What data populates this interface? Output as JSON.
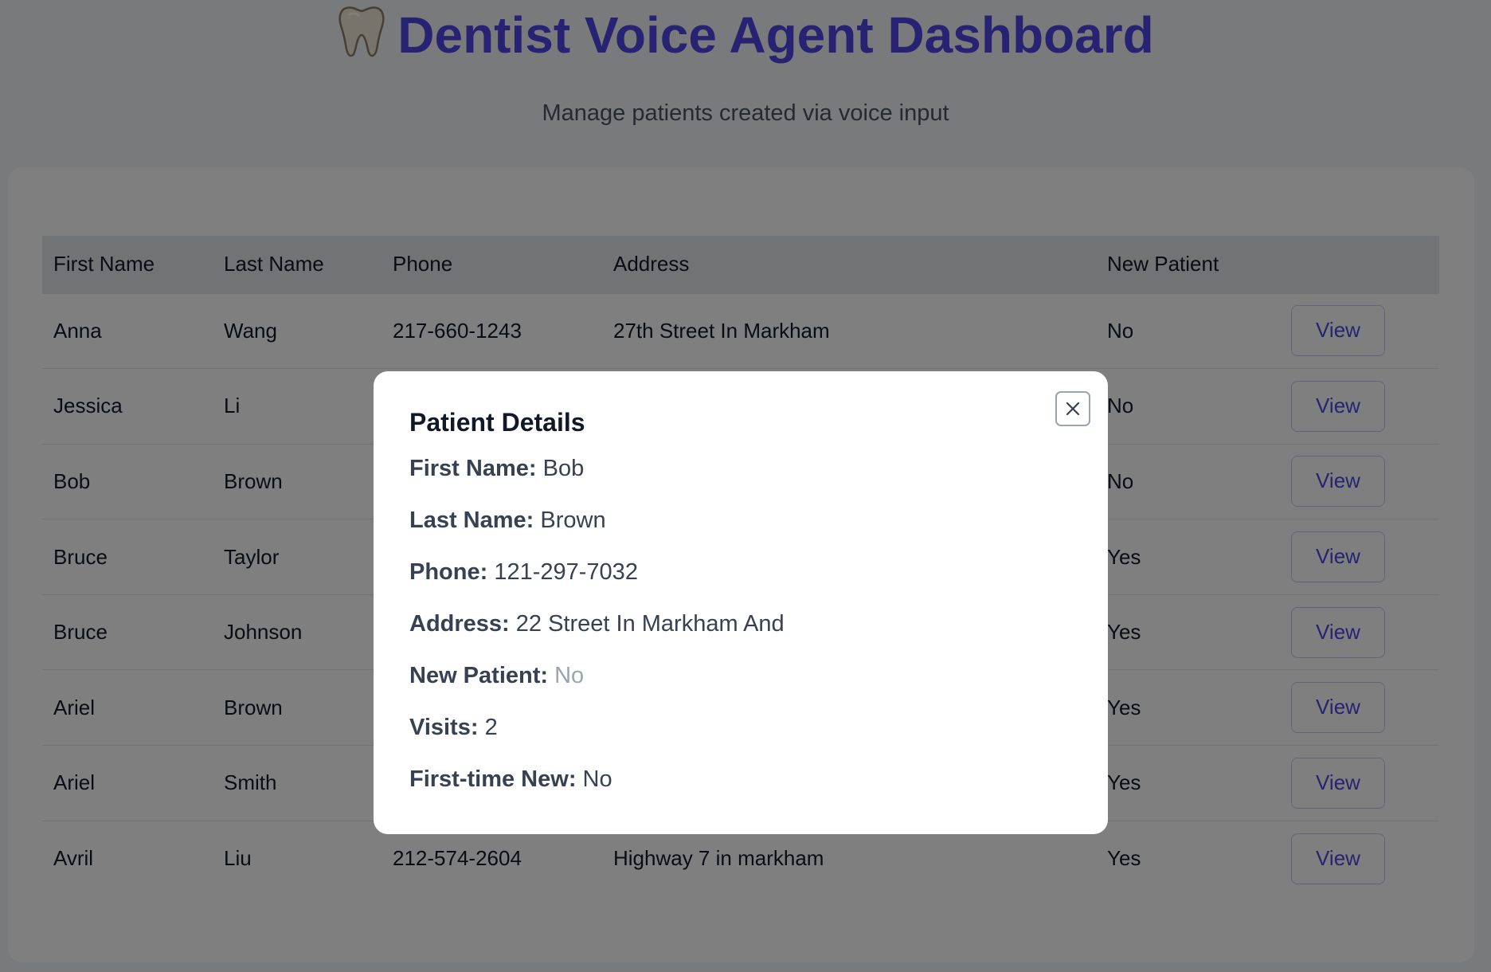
{
  "header": {
    "icon": "tooth-icon",
    "title": "Dentist Voice Agent Dashboard",
    "subtitle": "Manage patients created via voice input"
  },
  "table": {
    "columns": [
      "First Name",
      "Last Name",
      "Phone",
      "Address",
      "New Patient",
      ""
    ],
    "view_label": "View",
    "rows": [
      {
        "first": "Anna",
        "last": "Wang",
        "phone": "217-660-1243",
        "address": "27th Street In Markham",
        "new": "No"
      },
      {
        "first": "Jessica",
        "last": "Li",
        "phone": "",
        "address": "",
        "new": "No"
      },
      {
        "first": "Bob",
        "last": "Brown",
        "phone": "",
        "address": "",
        "new": "No"
      },
      {
        "first": "Bruce",
        "last": "Taylor",
        "phone": "",
        "address": "",
        "new": "Yes"
      },
      {
        "first": "Bruce",
        "last": "Johnson",
        "phone": "",
        "address": "",
        "new": "Yes"
      },
      {
        "first": "Ariel",
        "last": "Brown",
        "phone": "",
        "address": "",
        "new": "Yes"
      },
      {
        "first": "Ariel",
        "last": "Smith",
        "phone": "",
        "address": "",
        "new": "Yes"
      },
      {
        "first": "Avril",
        "last": "Liu",
        "phone": "212-574-2604",
        "address": "Highway 7 in markham",
        "new": "Yes"
      }
    ]
  },
  "modal": {
    "title": "Patient Details",
    "close_icon": "close-icon",
    "fields": [
      {
        "label": "First Name:",
        "value": "Bob"
      },
      {
        "label": "Last Name:",
        "value": "Brown"
      },
      {
        "label": "Phone:",
        "value": "121-297-7032"
      },
      {
        "label": "Address:",
        "value": "22 Street In Markham And"
      },
      {
        "label": "New Patient:",
        "value": "No",
        "muted": true
      },
      {
        "label": "Visits:",
        "value": "2"
      },
      {
        "label": "First-time New:",
        "value": "No"
      }
    ]
  },
  "colors": {
    "accent": "#4f46e5",
    "yes": "#16a34a",
    "no": "#9ca3af",
    "overlay": "rgba(0,0,0,0.5)"
  }
}
